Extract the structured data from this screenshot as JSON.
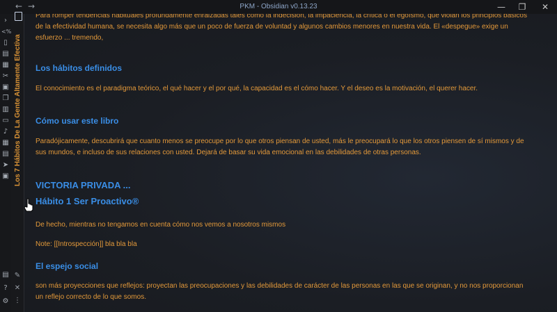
{
  "window": {
    "title": "PKM - Obsidian v0.13.23",
    "back_icon": "arrow-left-icon",
    "forward_icon": "arrow-right-icon"
  },
  "ribbon": {
    "icons": [
      "chevron-right-icon",
      "code-icon",
      "file-icon",
      "graph-icon",
      "pages-icon",
      "tools-icon",
      "calendar-icon",
      "copy-icon",
      "template-icon",
      "slides-icon",
      "mic-icon",
      "grid-icon",
      "send-icon",
      "calendar-alt-icon",
      "terminal-icon",
      "help-icon",
      "settings-icon"
    ]
  },
  "vertical_tab": {
    "title": "Los 7 Hábitos De La Gente Altamente Efectiva"
  },
  "content": {
    "intro": "Para romper tendencias habituales profundamente enraizadas tales como la indecisión, la impaciencia, la crítica o el egoísmo, que violan los principios básicos de la efectividad humana, se necesita algo más que un poco de fuerza de voluntad y algunos cambios menores en nuestra vida. El «despegue» exige un esfuerzo ... tremendo,",
    "h1": "Los hábitos definidos",
    "p1": "El conocimiento es el paradigma teórico, el qué hacer y el por qué, la capacidad es el cómo hacer. Y el deseo es la motivación, el querer hacer.",
    "h2": "Cómo usar este libro",
    "p2": "Paradójicamente, descubrirá que cuanto menos se preocupe por lo que otros piensan de usted, más le preocupará lo que los otros piensen de sí mismos y de sus mundos, e incluso de sus relaciones con usted. Dejará de basar su vida emocional en las debilidades de otras personas.",
    "h3": "VICTORIA PRIVADA ...",
    "h4": "Hábito 1 Ser Proactivo®",
    "p3": "De hecho, mientras no tengamos en cuenta cómo nos vemos a nosotros mismos",
    "p4": "Note: [[Introspección]] bla bla bla",
    "h5": "El espejo social",
    "p5": "son más proyecciones que reflejos: proyectan las preocupaciones y las debilidades de carácter de las personas en las que se originan, y no nos proporcionan un reflejo correcto de lo que somos."
  },
  "colors": {
    "text": "#e3993a",
    "heading": "#3a8ee6",
    "tab_title": "#d89236",
    "background": "#1b1d22"
  }
}
